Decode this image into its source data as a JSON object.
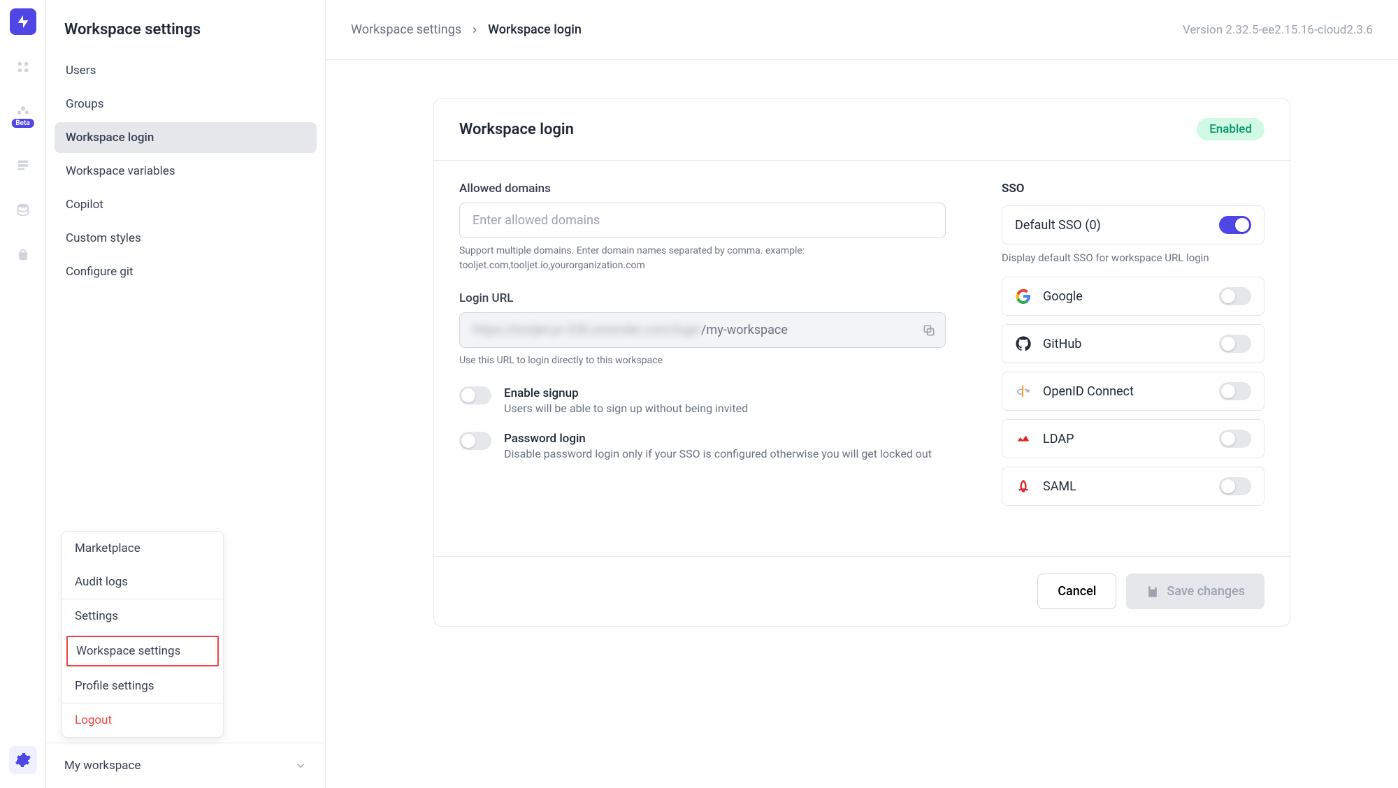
{
  "sidebar": {
    "title": "Workspace settings",
    "items": [
      "Users",
      "Groups",
      "Workspace login",
      "Workspace variables",
      "Copilot",
      "Custom styles",
      "Configure git"
    ],
    "active_index": 2,
    "workspace_label": "My workspace"
  },
  "iconbar": {
    "beta": "Beta"
  },
  "popup": {
    "items": [
      "Marketplace",
      "Audit logs",
      "Settings",
      "Workspace settings",
      "Profile settings",
      "Logout"
    ],
    "highlighted_index": 3
  },
  "breadcrumb": {
    "a": "Workspace settings",
    "b": "Workspace login"
  },
  "version": "Version 2.32.5-ee2.15.16-cloud2.3.6",
  "card": {
    "title": "Workspace login",
    "status": "Enabled",
    "allowed_domains_label": "Allowed domains",
    "allowed_domains_placeholder": "Enter allowed domains",
    "allowed_domains_help": "Support multiple domains. Enter domain names separated by comma. example: tooljet.com,tooljet.io,yourorganization.com",
    "login_url_label": "Login URL",
    "login_url_prefix": "https://tooljet-pr-338.onrender.com/login",
    "login_url_suffix": "/my-workspace",
    "login_url_help": "Use this URL to login directly to this workspace",
    "enable_signup_title": "Enable signup",
    "enable_signup_desc": "Users will be able to sign up without being invited",
    "password_login_title": "Password login",
    "password_login_desc": "Disable password login only if your SSO is configured otherwise you will get locked out",
    "sso_heading": "SSO",
    "default_sso_label": "Default SSO (0)",
    "default_sso_help": "Display default SSO for workspace URL login",
    "providers": [
      "Google",
      "GitHub",
      "OpenID Connect",
      "LDAP",
      "SAML"
    ],
    "cancel": "Cancel",
    "save": "Save changes"
  }
}
